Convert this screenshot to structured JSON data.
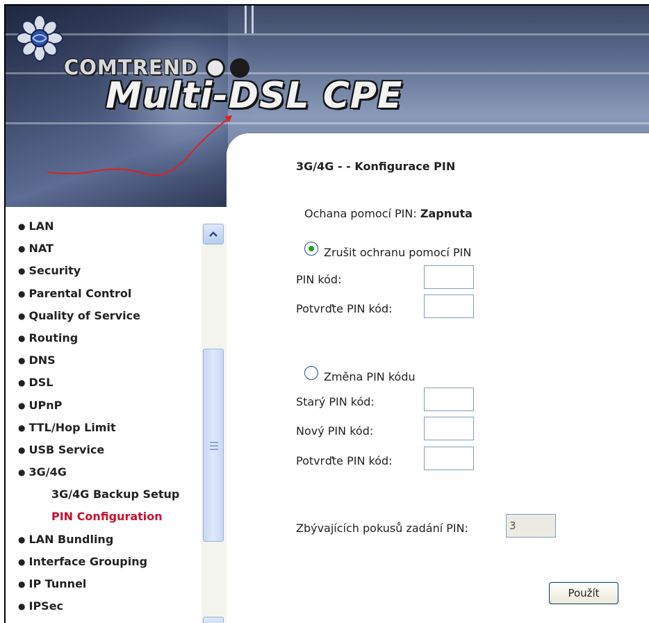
{
  "header": {
    "brand": "COMTREND",
    "product": "Multi-DSL CPE"
  },
  "sidebar": {
    "items": [
      {
        "label": "LAN",
        "bullet": "●"
      },
      {
        "label": "NAT",
        "bullet": "●"
      },
      {
        "label": "Security",
        "bullet": "●"
      },
      {
        "label": "Parental Control",
        "bullet": "●"
      },
      {
        "label": "Quality of Service",
        "bullet": "●"
      },
      {
        "label": "Routing",
        "bullet": "●"
      },
      {
        "label": "DNS",
        "bullet": "●"
      },
      {
        "label": "DSL",
        "bullet": "●"
      },
      {
        "label": "UPnP",
        "bullet": "●"
      },
      {
        "label": "TTL/Hop Limit",
        "bullet": "●"
      },
      {
        "label": "USB Service",
        "bullet": "●"
      },
      {
        "label": "3G/4G",
        "bullet": "●"
      },
      {
        "label": "3G/4G Backup Setup"
      },
      {
        "label": "PIN Configuration"
      },
      {
        "label": "LAN Bundling",
        "bullet": "●"
      },
      {
        "label": "Interface Grouping",
        "bullet": "●"
      },
      {
        "label": "IP Tunnel",
        "bullet": "●"
      },
      {
        "label": "IPSec",
        "bullet": "●"
      }
    ]
  },
  "main": {
    "title": "3G/4G - - Konfigurace PIN",
    "status_label": "Ochana pomocí PIN:",
    "status_value": "Zapnuta",
    "disable_section": {
      "radio_label": "Zrušit ochranu pomocí PIN",
      "selected": true,
      "pin_label": "PIN kód:",
      "confirm_label": "Potvrďte PIN kód:"
    },
    "change_section": {
      "radio_label": "Změna PIN kódu",
      "selected": false,
      "old_label": "Starý PIN kód:",
      "new_label": "Nový PIN kód:",
      "confirm_label": "Potvrďte PIN kód:"
    },
    "attempts_label": "Zbývajících pokusů zadání PIN:",
    "attempts_value": "3",
    "apply_label": "Použít"
  },
  "colors": {
    "active_menu": "#c8102e",
    "radio_dot": "#21a121"
  }
}
